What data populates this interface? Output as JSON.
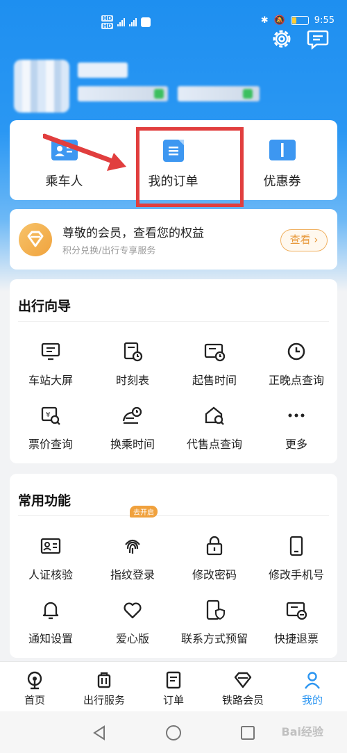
{
  "status": {
    "time": "9:55",
    "battery": "15"
  },
  "quick": [
    {
      "label": "乘车人",
      "icon": "passenger-card-icon"
    },
    {
      "label": "我的订单",
      "icon": "order-document-icon"
    },
    {
      "label": "优惠券",
      "icon": "coupon-ticket-icon"
    }
  ],
  "member": {
    "title": "尊敬的会员，查看您的权益",
    "subtitle": "积分兑换/出行专享服务",
    "button": "查看"
  },
  "travel_guide": {
    "title": "出行向导",
    "items": [
      "车站大屏",
      "时刻表",
      "起售时间",
      "正晚点查询",
      "票价查询",
      "换乘时间",
      "代售点查询",
      "更多"
    ]
  },
  "common": {
    "title": "常用功能",
    "badge": "去开启",
    "items": [
      "人证核验",
      "指纹登录",
      "修改密码",
      "修改手机号",
      "通知设置",
      "爱心版",
      "联系方式预留",
      "快捷退票"
    ]
  },
  "tabs": [
    {
      "label": "首页",
      "icon": "home-train-icon"
    },
    {
      "label": "出行服务",
      "icon": "luggage-icon"
    },
    {
      "label": "订单",
      "icon": "order-icon"
    },
    {
      "label": "铁路会员",
      "icon": "diamond-icon"
    },
    {
      "label": "我的",
      "icon": "user-icon",
      "active": true
    }
  ],
  "watermark": "Bai经验",
  "colors": {
    "brand": "#2b95f1",
    "highlight": "#e13e3e",
    "member_accent": "#f0a33d"
  }
}
